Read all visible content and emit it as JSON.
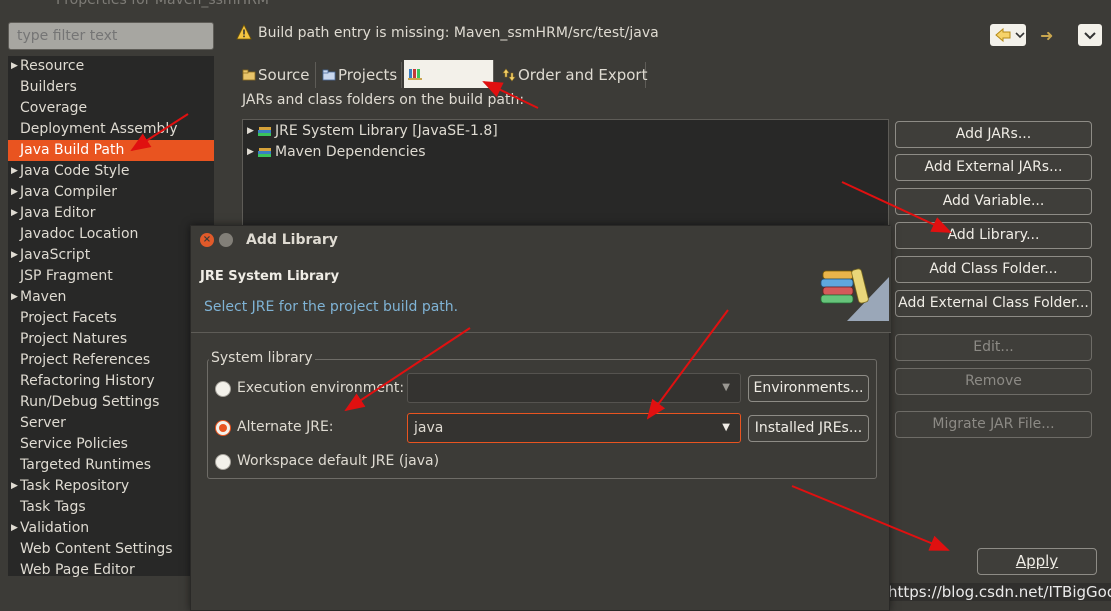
{
  "window": {
    "title": "Properties for Maven_ssmHRM"
  },
  "sidebar": {
    "filter_placeholder": "type filter text",
    "items": [
      {
        "label": "Resource",
        "expandable": true
      },
      {
        "label": "Builders",
        "expandable": false
      },
      {
        "label": "Coverage",
        "expandable": false
      },
      {
        "label": "Deployment Assembly",
        "expandable": false
      },
      {
        "label": "Java Build Path",
        "expandable": false,
        "selected": true
      },
      {
        "label": "Java Code Style",
        "expandable": true
      },
      {
        "label": "Java Compiler",
        "expandable": true
      },
      {
        "label": "Java Editor",
        "expandable": true
      },
      {
        "label": "Javadoc Location",
        "expandable": false
      },
      {
        "label": "JavaScript",
        "expandable": true
      },
      {
        "label": "JSP Fragment",
        "expandable": false
      },
      {
        "label": "Maven",
        "expandable": true
      },
      {
        "label": "Project Facets",
        "expandable": false
      },
      {
        "label": "Project Natures",
        "expandable": false
      },
      {
        "label": "Project References",
        "expandable": false
      },
      {
        "label": "Refactoring History",
        "expandable": false
      },
      {
        "label": "Run/Debug Settings",
        "expandable": false
      },
      {
        "label": "Server",
        "expandable": false
      },
      {
        "label": "Service Policies",
        "expandable": false
      },
      {
        "label": "Targeted Runtimes",
        "expandable": false
      },
      {
        "label": "Task Repository",
        "expandable": true
      },
      {
        "label": "Task Tags",
        "expandable": false
      },
      {
        "label": "Validation",
        "expandable": true
      },
      {
        "label": "Web Content Settings",
        "expandable": false
      },
      {
        "label": "Web Page Editor",
        "expandable": false
      }
    ]
  },
  "message": {
    "icon": "warning-icon",
    "text": "Build path entry is missing: Maven_ssmHRM/src/test/java"
  },
  "tabs": [
    {
      "label": "Source",
      "icon": "source-folder-icon"
    },
    {
      "label": "Projects",
      "icon": "projects-icon"
    },
    {
      "label": "",
      "icon": "libraries-icon",
      "active": true
    },
    {
      "label": "Order and Export",
      "icon": "order-export-icon"
    }
  ],
  "build_path": {
    "description": "JARs and class folders on the build path:",
    "entries": [
      {
        "label": "JRE System Library [JavaSE-1.8]",
        "icon": "library-icon"
      },
      {
        "label": "Maven Dependencies",
        "icon": "library-icon"
      }
    ]
  },
  "buttons": {
    "add_jars": "Add JARs...",
    "add_external_jars": "Add External JARs...",
    "add_variable": "Add Variable...",
    "add_library": "Add Library...",
    "add_class_folder": "Add Class Folder...",
    "add_external_class_folder": "Add External Class Folder...",
    "edit": "Edit...",
    "remove": "Remove",
    "migrate_jar": "Migrate JAR File...",
    "apply": "Apply"
  },
  "dialog": {
    "title": "Add Library",
    "heading": "JRE System Library",
    "subtitle": "Select JRE for the project build path.",
    "group_label": "System library",
    "options": {
      "execution_env": "Execution environment:",
      "alternate_jre": "Alternate JRE:",
      "workspace_default": "Workspace default JRE (java)"
    },
    "selected_option": "alternate_jre",
    "execution_env_value": "",
    "alternate_jre_value": "java",
    "environments_button": "Environments...",
    "installed_jres_button": "Installed JREs..."
  },
  "watermark": "https://blog.csdn.net/ITBigGod",
  "colors": {
    "accent": "#e95420",
    "annotation_arrow": "#e01010",
    "link_text": "#7fb3d5"
  }
}
